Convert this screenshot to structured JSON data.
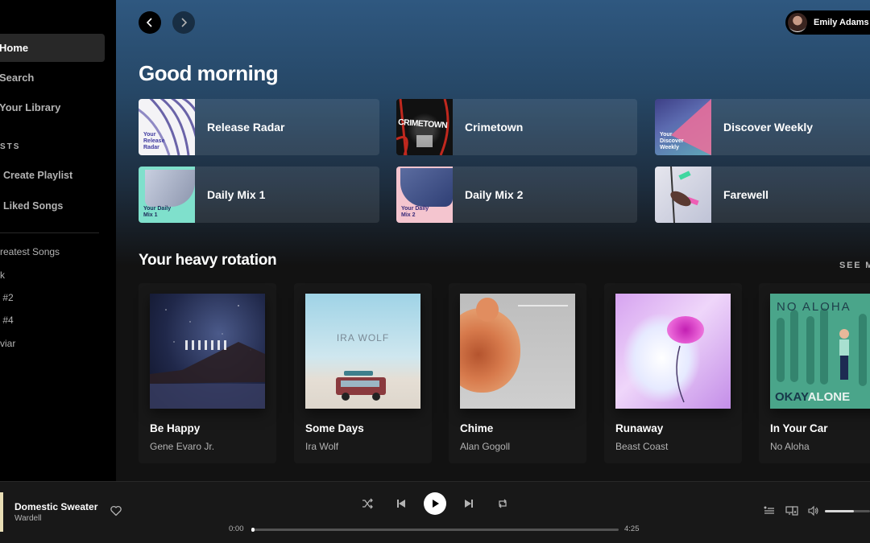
{
  "sidebar": {
    "nav": [
      {
        "label": "Home",
        "icon": "home-icon",
        "active": true
      },
      {
        "label": "Search",
        "icon": "search-icon",
        "active": false
      },
      {
        "label": "Your Library",
        "icon": "library-icon",
        "active": false
      }
    ],
    "section_label": "STS",
    "actions": [
      {
        "label": "Create Playlist",
        "icon": "plus-icon"
      },
      {
        "label": "Liked Songs",
        "icon": "heart-icon"
      }
    ],
    "playlists": [
      "reatest Songs",
      "k",
      " #2",
      " #4",
      "viar"
    ]
  },
  "header": {
    "back_icon": "chevron-left-icon",
    "forward_icon": "chevron-right-icon",
    "user_name": "Emily Adams"
  },
  "main": {
    "greeting": "Good morning",
    "shortcuts": [
      {
        "title": "Release Radar",
        "art_label": "Your Release Radar"
      },
      {
        "title": "Crimetown",
        "art_label": "CRIMETOWN"
      },
      {
        "title": "Discover Weekly",
        "art_label": "Your Discover Weekly"
      },
      {
        "title": "Daily Mix 1",
        "art_label": "Your Daily Mix 1"
      },
      {
        "title": "Daily Mix 2",
        "art_label": "Your Daily Mix 2"
      },
      {
        "title": "Farewell",
        "art_label": ""
      }
    ],
    "heavy_rotation": {
      "title": "Your heavy rotation",
      "see_more": "SEE MORE",
      "items": [
        {
          "title": "Be Happy",
          "artist": "Gene Evaro Jr."
        },
        {
          "title": "Some Days",
          "artist": "Ira Wolf",
          "cover_text": "IRA WOLF"
        },
        {
          "title": "Chime",
          "artist": "Alan Gogoll"
        },
        {
          "title": "Runaway",
          "artist": "Beast Coast"
        },
        {
          "title": "In Your Car",
          "artist": "No Aloha",
          "cover_text_top": "NO ALOHA",
          "cover_text_bottom_a": "OKAY",
          "cover_text_bottom_b": "ALONE"
        }
      ]
    }
  },
  "player": {
    "track": "Domestic Sweater",
    "artist": "Wardell",
    "elapsed": "0:00",
    "duration": "4:25",
    "progress_fraction": 0.0,
    "volume_fraction": 0.65
  }
}
